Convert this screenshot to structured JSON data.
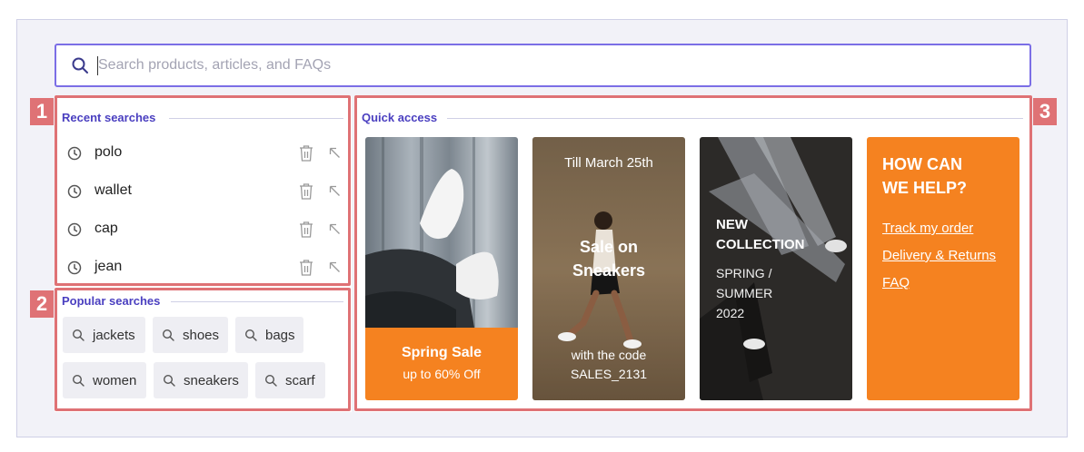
{
  "search": {
    "placeholder": "Search products, articles, and FAQs"
  },
  "badges": {
    "recent": "1",
    "popular": "2",
    "quick": "3"
  },
  "recent": {
    "title": "Recent searches",
    "items": [
      "polo",
      "wallet",
      "cap",
      "jean"
    ]
  },
  "popular": {
    "title": "Popular searches",
    "chips": [
      "jackets",
      "shoes",
      "bags",
      "women",
      "sneakers",
      "scarf"
    ]
  },
  "quick": {
    "title": "Quick access",
    "cards": {
      "spring": {
        "title": "Spring Sale",
        "subtitle": "up to 60% Off"
      },
      "sneakers": {
        "top": "Till March 25th",
        "title_1": "Sale on",
        "title_2": "Sneakers",
        "code_line_1": "with the code",
        "code_line_2": "SALES_2131"
      },
      "collection": {
        "title_1": "NEW",
        "title_2": "COLLECTION",
        "sub_1": "SPRING /",
        "sub_2": "SUMMER",
        "sub_3": "2022"
      },
      "help": {
        "title_1": "HOW CAN",
        "title_2": "WE HELP?",
        "links": [
          "Track my order",
          "Delivery & Returns",
          "FAQ"
        ]
      }
    }
  },
  "colors": {
    "accent": "#4a3fc0",
    "highlight": "#df7275",
    "orange": "#f58220"
  }
}
